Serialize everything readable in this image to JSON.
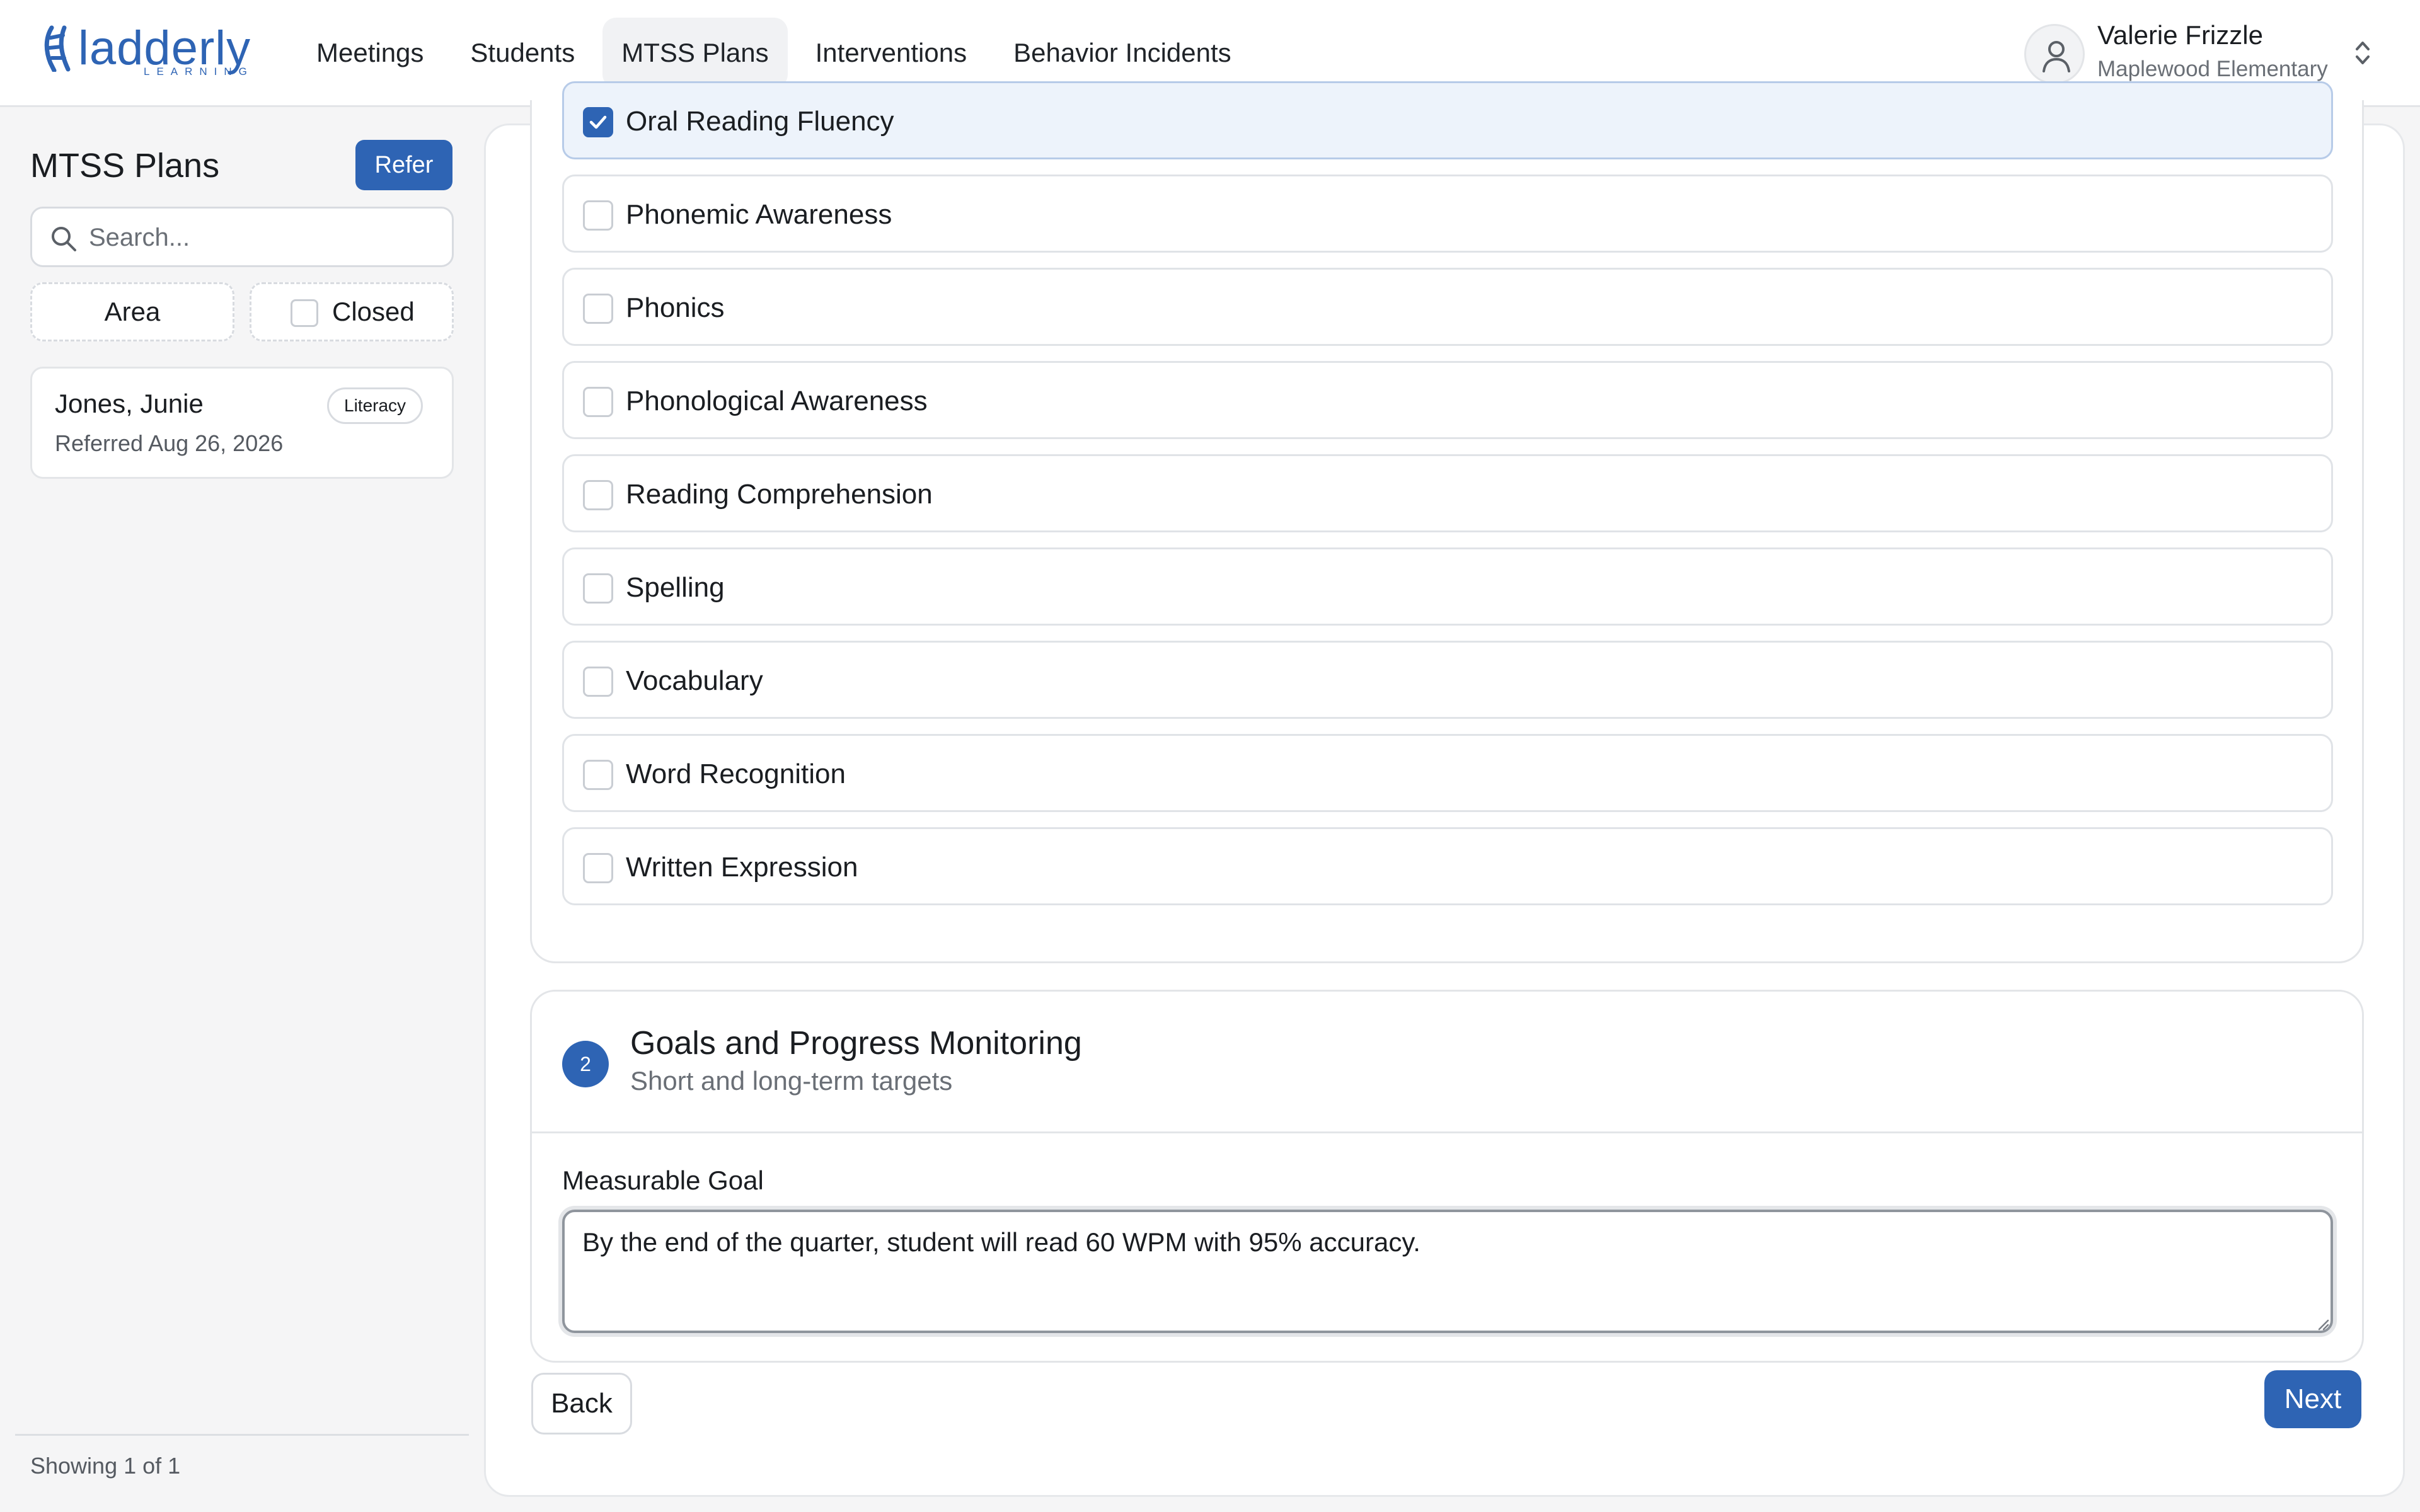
{
  "logo": {
    "wordmark": "ladderly",
    "tagline": "LEARNING"
  },
  "nav": {
    "items": [
      {
        "label": "Meetings",
        "active": false
      },
      {
        "label": "Students",
        "active": false
      },
      {
        "label": "MTSS Plans",
        "active": true
      },
      {
        "label": "Interventions",
        "active": false
      },
      {
        "label": "Behavior Incidents",
        "active": false
      }
    ]
  },
  "user": {
    "name": "Valerie Frizzle",
    "school": "Maplewood Elementary",
    "avatar_icon": "user-icon",
    "switcher_icon": "chevron-up-down-icon"
  },
  "sidebar": {
    "title": "MTSS Plans",
    "refer_label": "Refer",
    "search_placeholder": "Search...",
    "filters": {
      "area_label": "Area",
      "closed_label": "Closed",
      "closed_checked": false
    },
    "plans": [
      {
        "name": "Jones, Junie",
        "badge": "Literacy",
        "referred": "Referred Aug 26, 2026"
      }
    ],
    "footer": "Showing 1 of 1"
  },
  "areas": {
    "options": [
      {
        "label": "Oral Reading Fluency",
        "checked": true
      },
      {
        "label": "Phonemic Awareness",
        "checked": false
      },
      {
        "label": "Phonics",
        "checked": false
      },
      {
        "label": "Phonological Awareness",
        "checked": false
      },
      {
        "label": "Reading Comprehension",
        "checked": false
      },
      {
        "label": "Spelling",
        "checked": false
      },
      {
        "label": "Vocabulary",
        "checked": false
      },
      {
        "label": "Word Recognition",
        "checked": false
      },
      {
        "label": "Written Expression",
        "checked": false
      }
    ]
  },
  "goals": {
    "step_number": "2",
    "title": "Goals and Progress Monitoring",
    "subtitle": "Short and long-term targets",
    "field_label": "Measurable Goal",
    "goal_value": "By the end of the quarter, student will read 60 WPM with 95% accuracy."
  },
  "actions": {
    "back_label": "Back",
    "next_label": "Next"
  },
  "colors": {
    "accent": "#2e64b4",
    "checked_row_bg": "#edf3fb"
  }
}
